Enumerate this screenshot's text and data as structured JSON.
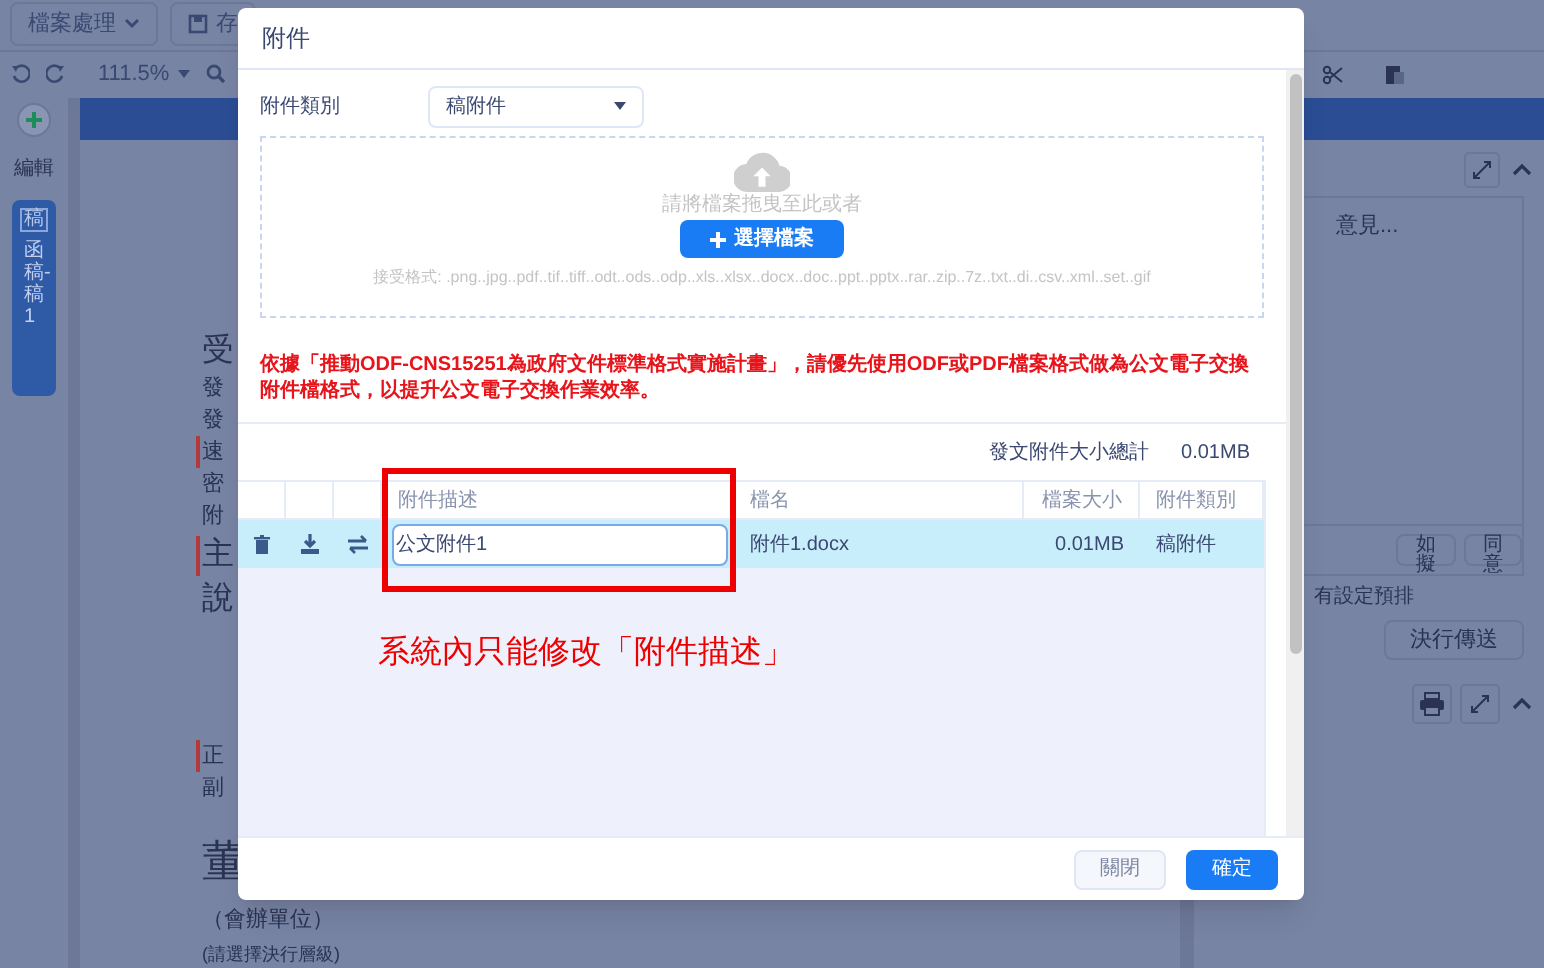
{
  "app": {
    "file_menu": "檔案處理",
    "save_button": "存",
    "zoom": "111.5%",
    "sidebar": {
      "edit_label": "編輯",
      "tab_icon": "稿",
      "tab_label": "函稿-稿1",
      "tab_selected": true
    },
    "document": {
      "lines": [
        {
          "text": "受",
          "kind": "large",
          "marked": false
        },
        {
          "text": "發",
          "kind": "normal",
          "marked": false
        },
        {
          "text": "發",
          "kind": "normal",
          "marked": false
        },
        {
          "text": "速",
          "kind": "normal",
          "marked": true
        },
        {
          "text": "密",
          "kind": "normal",
          "marked": false
        },
        {
          "text": "附",
          "kind": "normal",
          "marked": false
        },
        {
          "text": "主",
          "kind": "large",
          "marked": true
        },
        {
          "text": "說",
          "kind": "large",
          "marked": false
        },
        {
          "text": "正",
          "kind": "normal",
          "marked": true
        },
        {
          "text": "副",
          "kind": "normal",
          "marked": false
        },
        {
          "text": "董",
          "kind": "huge",
          "marked": false
        },
        {
          "text": "（會辦單位）",
          "kind": "normal",
          "marked": false
        },
        {
          "text": "(請選擇決行層級)",
          "kind": "small",
          "marked": false
        }
      ]
    },
    "right_panel": {
      "comment_placeholder": "意見...",
      "buttons": [
        "如擬",
        "同意"
      ],
      "schedule_note": "有設定預排",
      "send_button": "決行傳送"
    }
  },
  "dialog": {
    "title": "附件",
    "category": {
      "label": "附件類別",
      "value": "稿附件"
    },
    "dropzone": {
      "hint": "請將檔案拖曳至此或者",
      "button": "選擇檔案",
      "formats": "接受格式: .png..jpg..pdf..tif..tiff..odt..ods..odp..xls..xlsx..docx..doc..ppt..pptx..rar..zip..7z..txt..di..csv..xml..set..gif"
    },
    "notice": "依據「推動ODF-CNS15251為政府文件標準格式實施計畫」，請優先使用ODF或PDF檔案格式做為公文電子交換附件檔格式，以提升公文電子交換作業效率。",
    "total": {
      "label": "發文附件大小總計",
      "value": "0.01MB"
    },
    "table": {
      "columns": [
        "附件描述",
        "檔名",
        "檔案大小",
        "附件類別"
      ],
      "rows": [
        {
          "description": "公文附件1",
          "filename": "附件1.docx",
          "size": "0.01MB",
          "category": "稿附件",
          "selected": true
        }
      ]
    },
    "annotation": "系統內只能修改「附件描述」",
    "buttons": [
      {
        "label": "關閉",
        "kind": "secondary"
      },
      {
        "label": "確定",
        "kind": "primary"
      }
    ]
  }
}
